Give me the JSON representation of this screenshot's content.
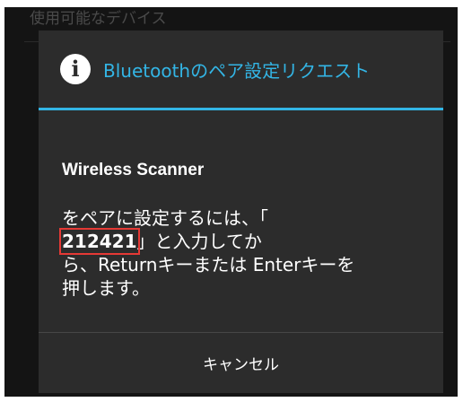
{
  "background": {
    "section_header": "使用可能なデバイス"
  },
  "dialog": {
    "icon": "info-icon",
    "title": "Bluetoothのペア設定リクエスト",
    "device_name": "Wireless Scanner",
    "message": {
      "line1": "をペアに設定するには、「",
      "pin": "212421",
      "line2_rest": "」と入力してか",
      "line3": "ら、Returnキーまたは Enterキーを",
      "line4": "押します。"
    },
    "cancel_label": "キャンセル"
  },
  "colors": {
    "accent": "#33b5e5",
    "dialog_background": "#2c2c2c",
    "screen_background": "#141414",
    "pin_highlight": "#e53935"
  }
}
